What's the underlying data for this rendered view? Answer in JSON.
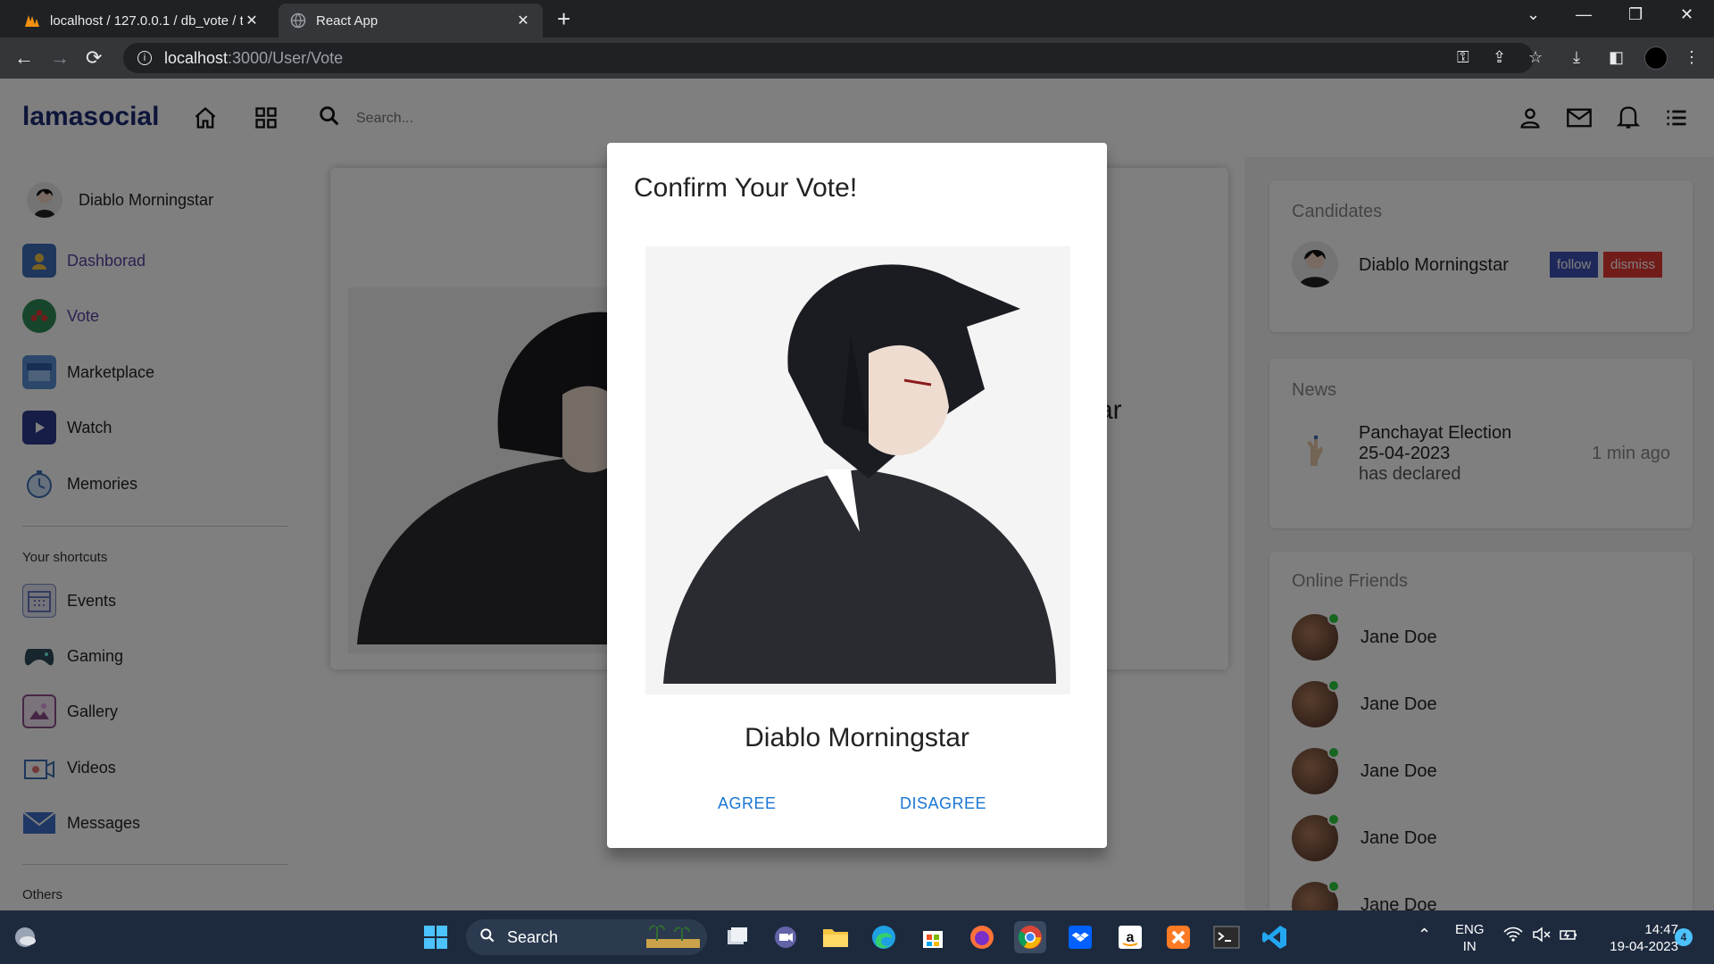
{
  "browser": {
    "tabs": [
      {
        "title": "localhost / 127.0.0.1 / db_vote / t",
        "active": false
      },
      {
        "title": "React App",
        "active": true
      }
    ],
    "url_host": "localhost",
    "url_path": ":3000/User/Vote"
  },
  "app": {
    "logo": "lamasocial",
    "search_placeholder": "Search...",
    "user_name": "Diablo Morningstar",
    "sidebar": {
      "items": [
        {
          "label": "Dashborad",
          "icon": "dashboard-icon"
        },
        {
          "label": "Vote",
          "icon": "vote-icon"
        },
        {
          "label": "Marketplace",
          "icon": "marketplace-icon"
        },
        {
          "label": "Watch",
          "icon": "watch-icon"
        },
        {
          "label": "Memories",
          "icon": "memories-icon"
        }
      ],
      "shortcuts_heading": "Your shortcuts",
      "shortcuts": [
        {
          "label": "Events",
          "icon": "events-icon"
        },
        {
          "label": "Gaming",
          "icon": "gaming-icon"
        },
        {
          "label": "Gallery",
          "icon": "gallery-icon"
        },
        {
          "label": "Videos",
          "icon": "videos-icon"
        },
        {
          "label": "Messages",
          "icon": "messages-icon"
        }
      ],
      "others_heading": "Others"
    },
    "main_card_partial_text": "ar",
    "right": {
      "candidates_title": "Candidates",
      "candidate_name": "Diablo Morningstar",
      "follow_label": "follow",
      "dismiss_label": "dismiss",
      "news_title": "News",
      "news_line1": "Panchayat Election",
      "news_line2": "25-04-2023",
      "news_line3": "has declared",
      "news_time": "1 min ago",
      "online_title": "Online Friends",
      "friends": [
        "Jane Doe",
        "Jane Doe",
        "Jane Doe",
        "Jane Doe",
        "Jane Doe"
      ]
    }
  },
  "dialog": {
    "title": "Confirm Your Vote!",
    "candidate_name": "Diablo Morningstar",
    "agree_label": "AGREE",
    "disagree_label": "DISAGREE"
  },
  "taskbar": {
    "search_label": "Search",
    "lang_line1": "ENG",
    "lang_line2": "IN",
    "time": "14:47",
    "date": "19-04-2023",
    "notification_count": "4"
  },
  "colors": {
    "logo": "#1c2a74",
    "follow": "#3f51b5",
    "dismiss": "#e53935",
    "dialog_button": "#1976d2",
    "online_dot": "#2ecc40"
  }
}
